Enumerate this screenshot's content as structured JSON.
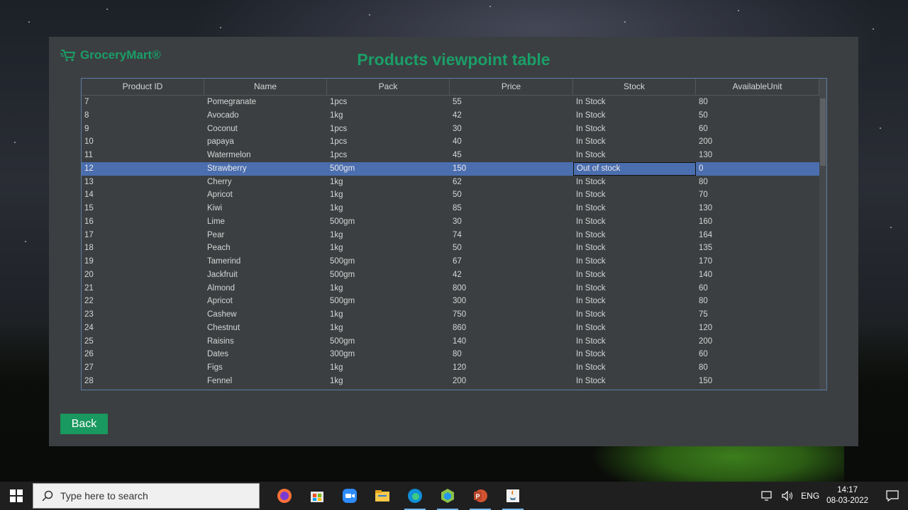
{
  "app": {
    "brand": "GroceryMart®",
    "title": "Products viewpoint table",
    "back_label": "Back"
  },
  "table": {
    "columns": [
      "Product ID",
      "Name",
      "Pack",
      "Price",
      "Stock",
      "AvailableUnit"
    ],
    "selected_row": 5,
    "rows": [
      [
        "7",
        "Pomegranate",
        "1pcs",
        "55",
        "In Stock",
        "80"
      ],
      [
        "8",
        "Avocado",
        "1kg",
        "42",
        "In Stock",
        "50"
      ],
      [
        "9",
        "Coconut",
        "1pcs",
        "30",
        "In Stock",
        "60"
      ],
      [
        "10",
        "papaya",
        "1pcs",
        "40",
        "In Stock",
        "200"
      ],
      [
        "11",
        "Watermelon",
        "1pcs",
        "45",
        "In Stock",
        "130"
      ],
      [
        "12",
        "Strawberry",
        "500gm",
        "150",
        "Out of stock",
        "0"
      ],
      [
        "13",
        "Cherry",
        "1kg",
        "62",
        "In Stock",
        "80"
      ],
      [
        "14",
        "Apricot",
        "1kg",
        "50",
        "In Stock",
        "70"
      ],
      [
        "15",
        "Kiwi",
        "1kg",
        "85",
        "In Stock",
        "130"
      ],
      [
        "16",
        "Lime",
        "500gm",
        "30",
        "In Stock",
        "160"
      ],
      [
        "17",
        "Pear",
        "1kg",
        "74",
        "In Stock",
        "164"
      ],
      [
        "18",
        "Peach",
        "1kg",
        "50",
        "In Stock",
        "135"
      ],
      [
        "19",
        "Tamerind",
        "500gm",
        "67",
        "In Stock",
        "170"
      ],
      [
        "20",
        "Jackfruit",
        "500gm",
        "42",
        "In Stock",
        "140"
      ],
      [
        "21",
        "Almond",
        "1kg",
        "800",
        "In Stock",
        "60"
      ],
      [
        "22",
        "Apricot",
        "500gm",
        "300",
        "In Stock",
        "80"
      ],
      [
        "23",
        "Cashew",
        "1kg",
        "750",
        "In Stock",
        "75"
      ],
      [
        "24",
        "Chestnut",
        "1kg",
        "860",
        "In Stock",
        "120"
      ],
      [
        "25",
        "Raisins",
        "500gm",
        "140",
        "In Stock",
        "200"
      ],
      [
        "26",
        "Dates",
        "300gm",
        "80",
        "In Stock",
        "60"
      ],
      [
        "27",
        "Figs",
        "1kg",
        "120",
        "In Stock",
        "80"
      ],
      [
        "28",
        "Fennel",
        "1kg",
        "200",
        "In Stock",
        "150"
      ]
    ]
  },
  "taskbar": {
    "search_placeholder": "Type here to search",
    "language": "ENG",
    "time": "14:17",
    "date": "08-03-2022",
    "apps": [
      "firefox-icon",
      "store-icon",
      "zoom-icon",
      "file-explorer-icon",
      "edge-icon",
      "app-cube-icon",
      "powerpoint-icon",
      "java-icon"
    ]
  },
  "colors": {
    "accent": "#1a9e68",
    "selection": "#4b6eaf",
    "panel": "#3c3f41"
  }
}
